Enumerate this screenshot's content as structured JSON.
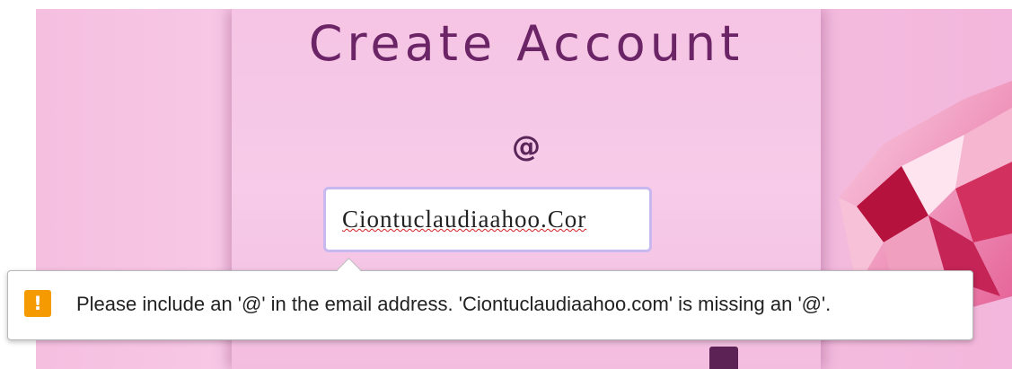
{
  "form": {
    "title": "Create Account",
    "email_icon": "@",
    "email_value": "Ciontuclaudiaahoo.Cor",
    "email_field_type": "email"
  },
  "validation_tooltip": {
    "icon": "!",
    "message": "Please include an '@' in the email address. 'Ciontuclaudiaahoo.com' is missing an '@'."
  },
  "colors": {
    "background": "#f5c0e1",
    "title": "#6b2466",
    "warning": "#f59a00",
    "input_border": "#c8b8f0"
  },
  "icons": [
    "at-icon",
    "warning-icon",
    "diamond-decoration"
  ]
}
